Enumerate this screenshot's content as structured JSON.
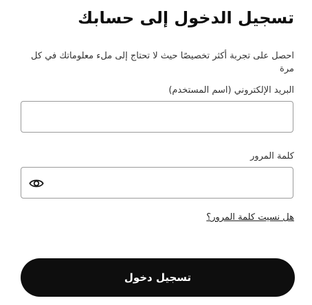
{
  "header": {
    "title": "تسجيل الدخول إلى حسابك",
    "subtitle": "احصل على تجربة أكثر تخصيصًا حيث لا تحتاج إلى ملء معلوماتك في كل مرة"
  },
  "form": {
    "email": {
      "label": "البريد الإلكتروني (اسم المستخدم)",
      "value": "",
      "placeholder": ""
    },
    "password": {
      "label": "كلمة المرور",
      "value": "",
      "placeholder": "",
      "toggle_icon": "eye-icon"
    },
    "forgot_password": "هل نسيت كلمة المرور؟",
    "submit_label": "تسجيل دخول"
  },
  "colors": {
    "button_background": "#0e0e0e",
    "button_text": "#ffffff",
    "field_border": "#9a9a9a"
  }
}
